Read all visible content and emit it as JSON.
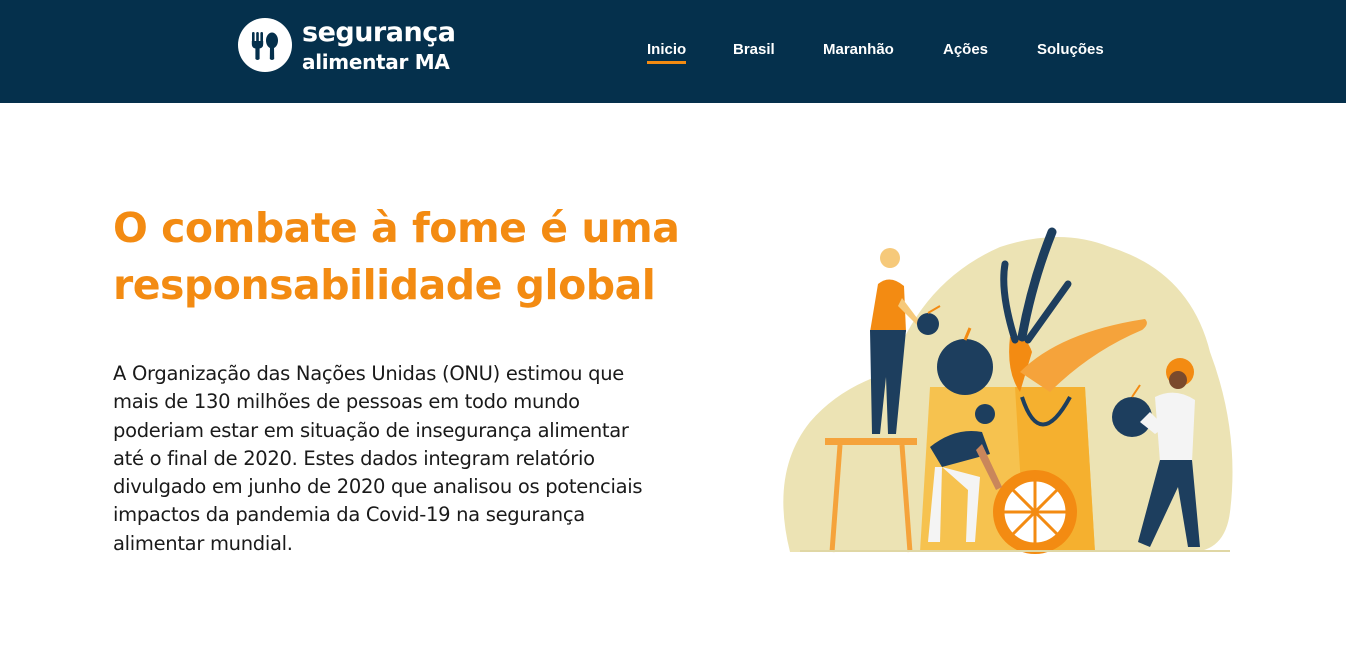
{
  "header": {
    "logo": {
      "line1": "segurança",
      "line2": "alimentar MA",
      "icon": "fork-spoon-icon"
    },
    "nav": [
      {
        "label": "Inicio",
        "active": true
      },
      {
        "label": "Brasil",
        "active": false
      },
      {
        "label": "Maranhão",
        "active": false
      },
      {
        "label": "Ações",
        "active": false
      },
      {
        "label": "Soluções",
        "active": false
      }
    ]
  },
  "hero": {
    "title": "O combate à fome é uma responsabilidade global",
    "paragraph": "A Organização das Nações Unidas (ONU) estimou que mais de 130 milhões de pessoas em todo mundo poderiam estar em situação de insegurança alimentar até o final de 2020. Estes dados integram relatório divulgado em junho de 2020 que analisou os potenciais impactos da pandemia da Covid-19 na segurança alimentar mundial.",
    "illustration": "food-donation-illustration"
  },
  "colors": {
    "header_bg": "#05304c",
    "accent": "#f38b12",
    "text": "#1a1a1a",
    "illustration_blob": "#ece3b4",
    "illustration_navy": "#1d3e5e"
  }
}
